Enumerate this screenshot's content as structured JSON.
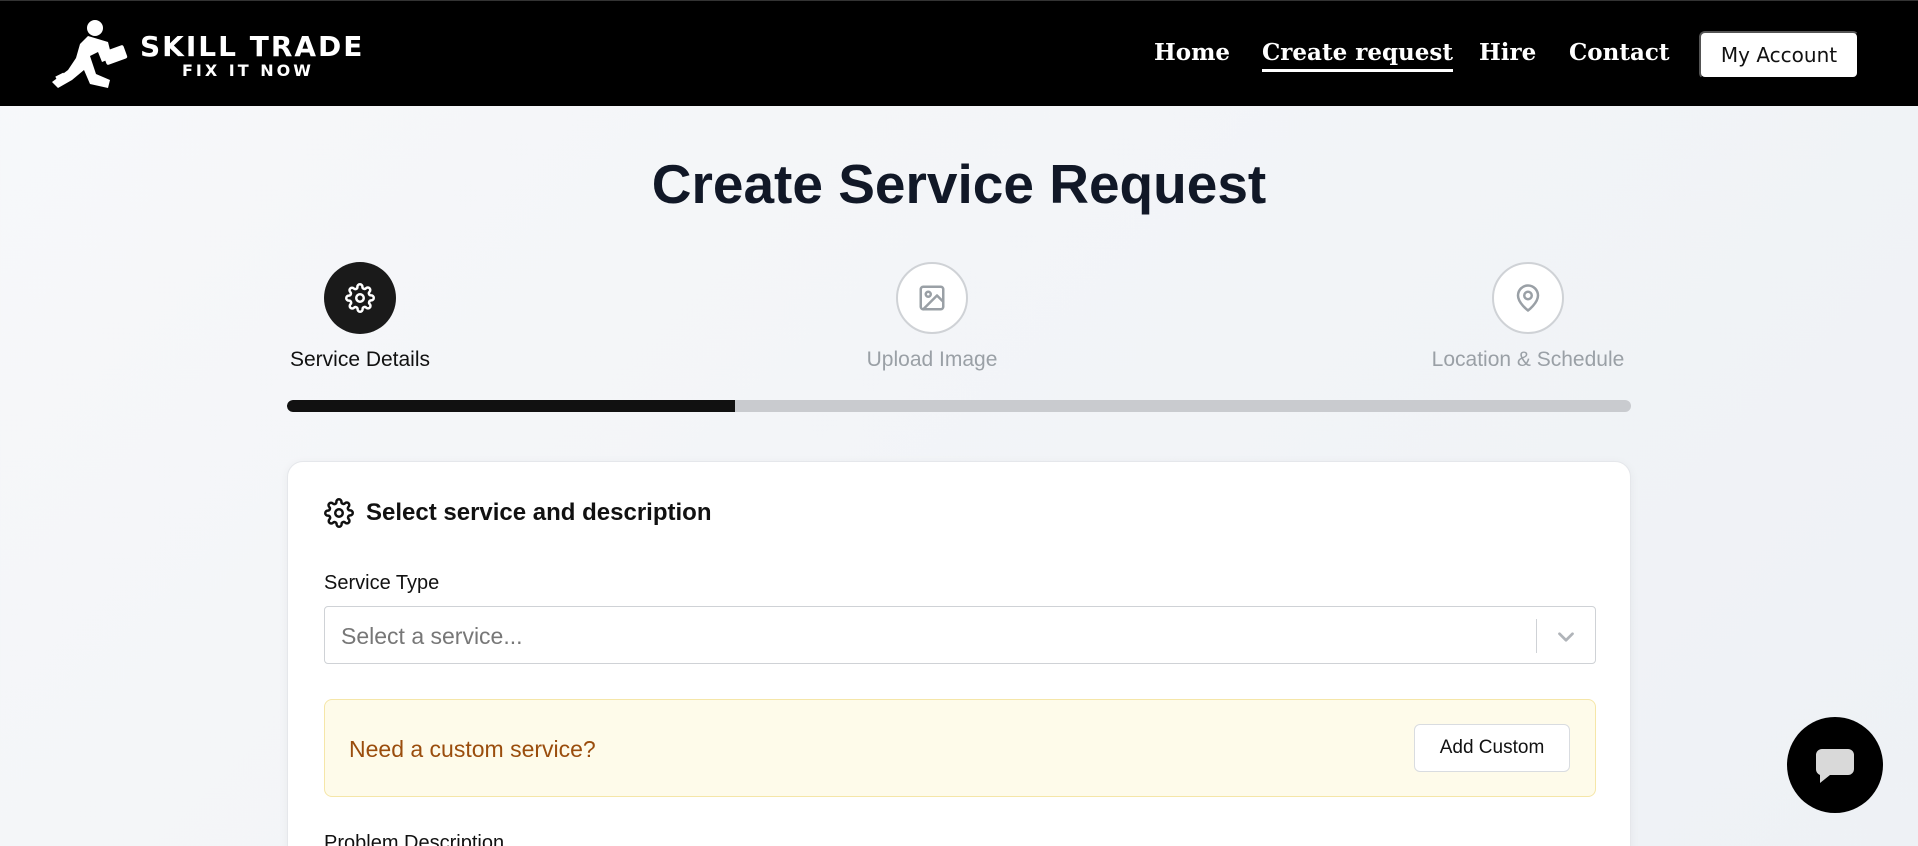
{
  "brand": {
    "title": "SKILL TRADE",
    "tagline": "FIX IT NOW"
  },
  "nav": {
    "links": [
      {
        "label": "Home"
      },
      {
        "label": "Create request",
        "active": true
      },
      {
        "label": "Hire"
      },
      {
        "label": "Contact"
      }
    ],
    "account_label": "My Account"
  },
  "page": {
    "title": "Create Service Request"
  },
  "stepper": {
    "steps": [
      {
        "label": "Service Details",
        "icon": "gear-icon",
        "state": "active"
      },
      {
        "label": "Upload Image",
        "icon": "image-icon",
        "state": "inactive"
      },
      {
        "label": "Location & Schedule",
        "icon": "location-pin-icon",
        "state": "inactive"
      }
    ],
    "progress_percent": 33.3
  },
  "card": {
    "title": "Select service and description",
    "title_icon": "gear-icon",
    "service_type": {
      "label": "Service Type",
      "placeholder": "Select a service..."
    },
    "custom": {
      "prompt": "Need a custom service?",
      "button_label": "Add Custom"
    },
    "problem_description_label": "Problem Description"
  },
  "chat": {
    "icon": "chat-bubble-icon"
  },
  "colors": {
    "navbar": "#000000",
    "accent_dark": "#111111",
    "custom_bg": "#fefbea",
    "custom_text": "#9a4d0d"
  }
}
